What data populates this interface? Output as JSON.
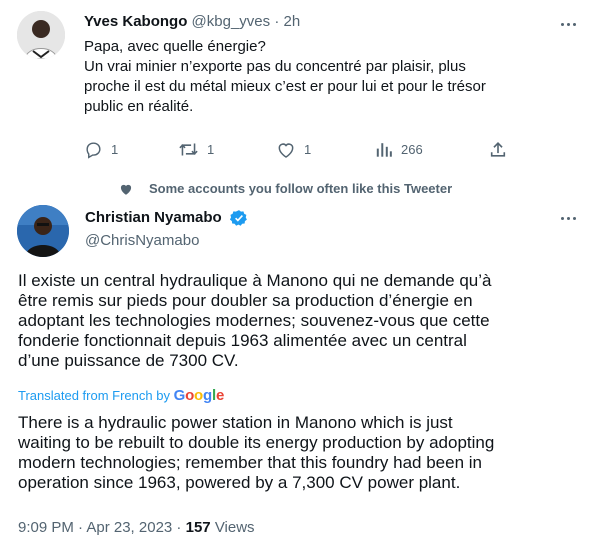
{
  "reply_tweet": {
    "display_name": "Yves Kabongo",
    "handle": "@kbg_yves",
    "separator": "·",
    "time": "2h",
    "text_lines": [
      "Papa, avec quelle énergie?",
      "Un vrai minier n’exporte pas du concentré par plaisir, plus",
      "proche il est du métal mieux c’est er pour lui et pour le trésor",
      "public en réalité."
    ],
    "actions": {
      "reply_count": "1",
      "retweet_count": "1",
      "like_count": "1",
      "views_count": "266"
    },
    "icons": [
      "reply-icon",
      "retweet-icon",
      "like-icon",
      "views-icon",
      "share-icon"
    ]
  },
  "social_context": {
    "text": "Some accounts you follow often like this Tweeter",
    "icon": "heart-icon"
  },
  "main_tweet": {
    "display_name": "Christian Nyamabo",
    "handle": "@ChrisNyamabo",
    "verified_color": "#1d9bf0",
    "original_text_lines": [
      "Il existe un central hydraulique à Manono qui ne demande qu’à",
      "être remis sur pieds pour doubler sa production d’énergie en",
      "adoptant les technologies modernes; souvenez-vous que cette",
      "fonderie fonctionnait depuis 1963 alimentée avec un central",
      "d’une puissance de 7300 CV."
    ],
    "translation_label": "Translated from French by",
    "translation_provider": "Google",
    "translated_text_lines": [
      "There is a hydraulic power station in Manono which is just",
      "waiting to be rebuilt to double its energy production by adopting",
      "modern technologies; remember that this foundry had been in",
      "operation since 1963, powered by a 7,300 CV power plant."
    ],
    "timestamp": "9:09 PM · Apr 23, 2023 ·",
    "views_count": "157",
    "views_label": "Views"
  },
  "colors": {
    "text": "#0f1419",
    "muted": "#536471",
    "link": "#1d9bf0",
    "divider": "#cfd9de"
  }
}
